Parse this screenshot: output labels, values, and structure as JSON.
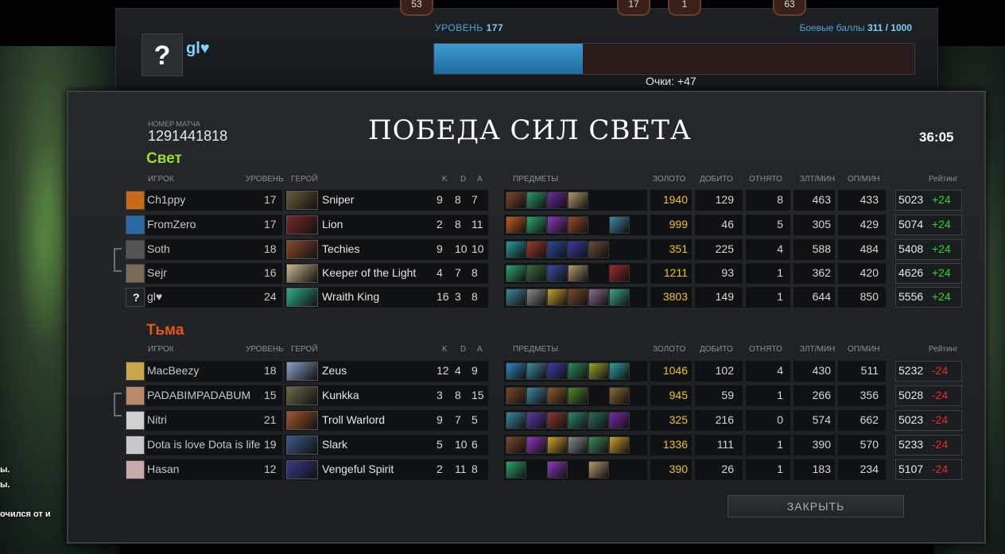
{
  "top": {
    "badges": [
      "53",
      "17",
      "1",
      "63"
    ],
    "level_label": "УРОВЕНЬ",
    "level_value": "177",
    "battle_label": "Боевые баллы",
    "battle_value": "311 / 1000",
    "xp_fraction": 0.31,
    "player_name": "gl♥",
    "avatar_symbol": "?",
    "points": "Очки: +47"
  },
  "match": {
    "number_label": "НОМЕР МАТЧА",
    "number": "1291441818",
    "title": "ПОБЕДА СИЛ СВЕТА",
    "duration": "36:05"
  },
  "headers": {
    "player": "ИГРОК",
    "level": "УРОВЕНЬ",
    "hero": "ГЕРОЙ",
    "k": "K",
    "d": "D",
    "a": "A",
    "items": "ПРЕДМЕТЫ",
    "gold": "ЗОЛОТО",
    "last_hits": "ДОБИТО",
    "denies": "ОТНЯТО",
    "gpm": "ЗЛТ/МИН",
    "xpm": "ОП/МИН",
    "rating": "Рейтинг"
  },
  "radiant": {
    "title": "Свет",
    "color": "#9ddc2a",
    "players": [
      {
        "name": "Ch1ppy",
        "level": "17",
        "hero": "Sniper",
        "k": "9",
        "d": "8",
        "a": "7",
        "gold": "1940",
        "lh": "129",
        "dn": "8",
        "gpm": "463",
        "xpm": "433",
        "rating": "5023",
        "delta": "+24",
        "icon_color": "#c96a1a",
        "hero_color": "#6a5a3a",
        "items": [
          "#7a4a2a",
          "#2a9a6a",
          "#6a2aa0",
          "#b49a6a"
        ]
      },
      {
        "name": "FromZero",
        "level": "17",
        "hero": "Lion",
        "k": "2",
        "d": "8",
        "a": "11",
        "gold": "999",
        "lh": "46",
        "dn": "5",
        "gpm": "305",
        "xpm": "429",
        "rating": "5074",
        "delta": "+24",
        "icon_color": "#2a6aa8",
        "hero_color": "#7a2a2a",
        "items": [
          "#c06020",
          "#2aa86a",
          "#8a3ac0",
          "#9a4a2a",
          "",
          "#3a8aa0"
        ]
      },
      {
        "name": "Soth",
        "level": "18",
        "hero": "Techies",
        "k": "9",
        "d": "10",
        "a": "10",
        "gold": "351",
        "lh": "225",
        "dn": "4",
        "gpm": "588",
        "xpm": "484",
        "rating": "5408",
        "delta": "+24",
        "icon_color": "#555555",
        "hero_color": "#8a4a2a",
        "items": [
          "#2a9aa0",
          "#a03a2a",
          "#2a4aa0",
          "#3a3aa8",
          "#6a4a3a"
        ]
      },
      {
        "name": "Sejr",
        "level": "16",
        "hero": "Keeper of the Light",
        "k": "4",
        "d": "7",
        "a": "8",
        "gold": "1211",
        "lh": "93",
        "dn": "1",
        "gpm": "362",
        "xpm": "420",
        "rating": "4626",
        "delta": "+24",
        "icon_color": "#7a6a5a",
        "hero_color": "#c8b88a",
        "items": [
          "#2aa86a",
          "#3a6a3a",
          "#3a4aa8",
          "#b49a6a",
          "",
          "#a02a2a"
        ]
      },
      {
        "name": "gl♥",
        "level": "24",
        "hero": "Wraith King",
        "k": "16",
        "d": "3",
        "a": "8",
        "gold": "3803",
        "lh": "149",
        "dn": "1",
        "gpm": "644",
        "xpm": "850",
        "rating": "5556",
        "delta": "+24",
        "icon_color": "#202326",
        "hero_color": "#2ab08a",
        "items": [
          "#3a8aa0",
          "#8a8a8a",
          "#c8a02a",
          "#7a4a2a",
          "#8a6a8a",
          "#3aa88a"
        ]
      }
    ]
  },
  "dire": {
    "title": "Тьма",
    "color": "#e8561a",
    "players": [
      {
        "name": "MacBeezy",
        "level": "18",
        "hero": "Zeus",
        "k": "12",
        "d": "4",
        "a": "9",
        "gold": "1046",
        "lh": "102",
        "dn": "4",
        "gpm": "430",
        "xpm": "511",
        "rating": "5232",
        "delta": "-24",
        "icon_color": "#c8a84a",
        "hero_color": "#8aa0c8",
        "items": [
          "#2a8ac0",
          "#3a8aa0",
          "#3a3aa8",
          "#2a8a5a",
          "#9aa02a",
          "#2aa0a0"
        ]
      },
      {
        "name": "PADABIMPADABUM",
        "level": "15",
        "hero": "Kunkka",
        "k": "3",
        "d": "8",
        "a": "15",
        "gold": "945",
        "lh": "59",
        "dn": "1",
        "gpm": "266",
        "xpm": "356",
        "rating": "5028",
        "delta": "-24",
        "icon_color": "#b88a6a",
        "hero_color": "#6a6a4a",
        "items": [
          "#7a4a2a",
          "#3a8aa0",
          "#8a5a2a",
          "#4a8a2a",
          "",
          "#8a6a3a"
        ]
      },
      {
        "name": "Nitri",
        "level": "21",
        "hero": "Troll Warlord",
        "k": "9",
        "d": "7",
        "a": "5",
        "gold": "325",
        "lh": "216",
        "dn": "0",
        "gpm": "574",
        "xpm": "662",
        "rating": "5023",
        "delta": "-24",
        "icon_color": "#d0d0d0",
        "hero_color": "#a05a2a",
        "items": [
          "#3a8aa0",
          "#5a3aa8",
          "#8a3a2a",
          "#2a8a6a",
          "#2a6a5a",
          "#7a2ab0"
        ]
      },
      {
        "name": "Dota is love Dota is life",
        "level": "19",
        "hero": "Slark",
        "k": "5",
        "d": "10",
        "a": "6",
        "gold": "1336",
        "lh": "111",
        "dn": "1",
        "gpm": "390",
        "xpm": "570",
        "rating": "5233",
        "delta": "-24",
        "icon_color": "#c8c8c8",
        "hero_color": "#3a5a8a",
        "items": [
          "#7a4a2a",
          "#8a3ac0",
          "#d0a02a",
          "#8a8a8a",
          "#3a8a5a",
          "#d0a02a"
        ]
      },
      {
        "name": "Hasan",
        "level": "12",
        "hero": "Vengeful Spirit",
        "k": "2",
        "d": "11",
        "a": "8",
        "gold": "390",
        "lh": "26",
        "dn": "1",
        "gpm": "183",
        "xpm": "234",
        "rating": "5107",
        "delta": "-24",
        "icon_color": "#c8a8a8",
        "hero_color": "#3a3a8a",
        "items": [
          "#2aa86a",
          "",
          "#8a3ac0",
          "",
          "#b49a6a"
        ]
      }
    ]
  },
  "close_label": "ЗАКРЫТЬ",
  "background_text": [
    "ы.",
    "ы.",
    "очился от и"
  ],
  "colors": {
    "positive": "#2bd62b",
    "negative": "#e82a2a",
    "gold": "#f2c316",
    "accent": "#4aa8e0"
  }
}
